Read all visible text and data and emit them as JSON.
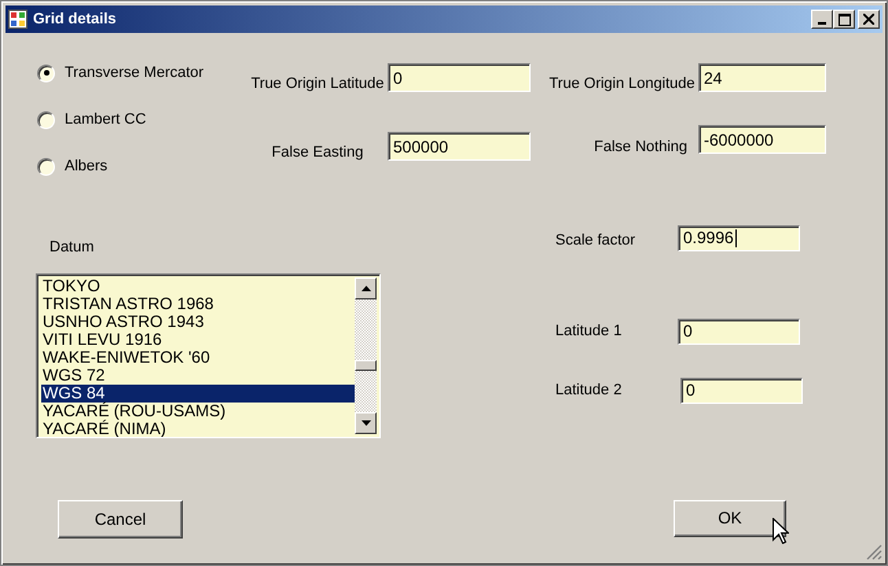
{
  "window": {
    "title": "Grid details"
  },
  "projection": [
    {
      "label": "Transverse Mercator",
      "selected": true
    },
    {
      "label": "Lambert CC",
      "selected": false
    },
    {
      "label": "Albers",
      "selected": false
    }
  ],
  "origin_fields": [
    {
      "label": "True Origin Latitude",
      "value": "0"
    },
    {
      "label": "True Origin Longitude",
      "value": "24"
    },
    {
      "label": "False Easting",
      "value": "500000"
    },
    {
      "label": "False Nothing",
      "value": "-6000000"
    }
  ],
  "datum": {
    "label": "Datum",
    "items": [
      {
        "text": "TOKYO",
        "selected": false
      },
      {
        "text": "TRISTAN ASTRO 1968",
        "selected": false
      },
      {
        "text": "USNHO ASTRO 1943",
        "selected": false
      },
      {
        "text": "VITI LEVU 1916",
        "selected": false
      },
      {
        "text": "WAKE-ENIWETOK '60",
        "selected": false
      },
      {
        "text": "WGS 72",
        "selected": false
      },
      {
        "text": "WGS 84",
        "selected": true
      },
      {
        "text": "YACARÉ (ROU-USAMS)",
        "selected": false
      },
      {
        "text": "YACARÉ (NIMA)",
        "selected": false
      }
    ]
  },
  "scale_fields": [
    {
      "label": "Scale factor",
      "value": "0.9996",
      "focused": true
    },
    {
      "label": "Latitude 1",
      "value": "0",
      "focused": false
    },
    {
      "label": "Latitude 2",
      "value": "0",
      "focused": false
    }
  ],
  "buttons": [
    {
      "label": "Cancel"
    },
    {
      "label": "OK"
    }
  ]
}
